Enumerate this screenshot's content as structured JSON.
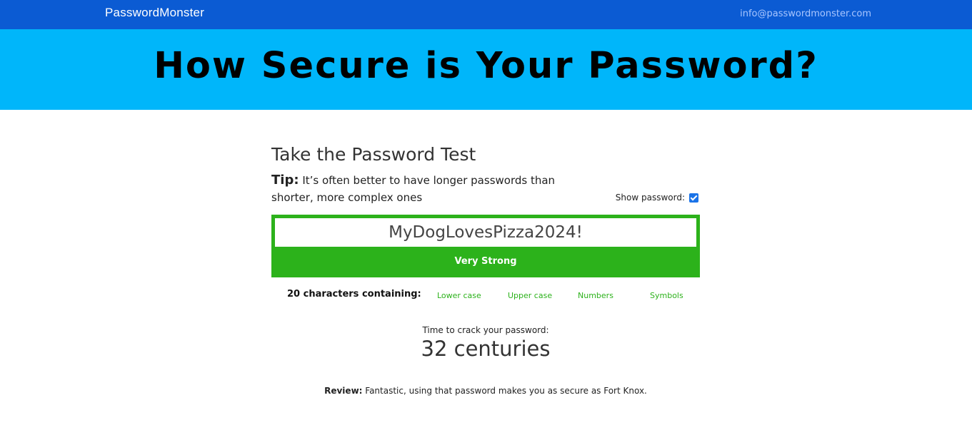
{
  "header": {
    "brand": "PasswordMonster",
    "email": "info@passwordmonster.com"
  },
  "hero": {
    "title": "How Secure is Your Password?"
  },
  "test": {
    "title": "Take the Password Test",
    "tip_label": "Tip:",
    "tip_text": "It’s often better to have longer passwords than shorter, more complex ones",
    "show_password_label": "Show password:",
    "show_password_checked": true,
    "password_value": "MyDogLovesPizza2024!",
    "strength_label": "Very Strong",
    "strength_color": "#2cb21b",
    "characters_summary": "20 characters containing:",
    "character_types": [
      "Lower case",
      "Upper case",
      "Numbers",
      "Symbols"
    ],
    "crack_label": "Time to crack your password:",
    "crack_value": "32 centuries",
    "review_label": "Review:",
    "review_text": "Fantastic, using that password makes you as secure as Fort Knox."
  },
  "colors": {
    "topbar": "#0b5bd3",
    "hero": "#00b6fa",
    "accent_green": "#2cb21b",
    "checkbox": "#1a73e8"
  }
}
